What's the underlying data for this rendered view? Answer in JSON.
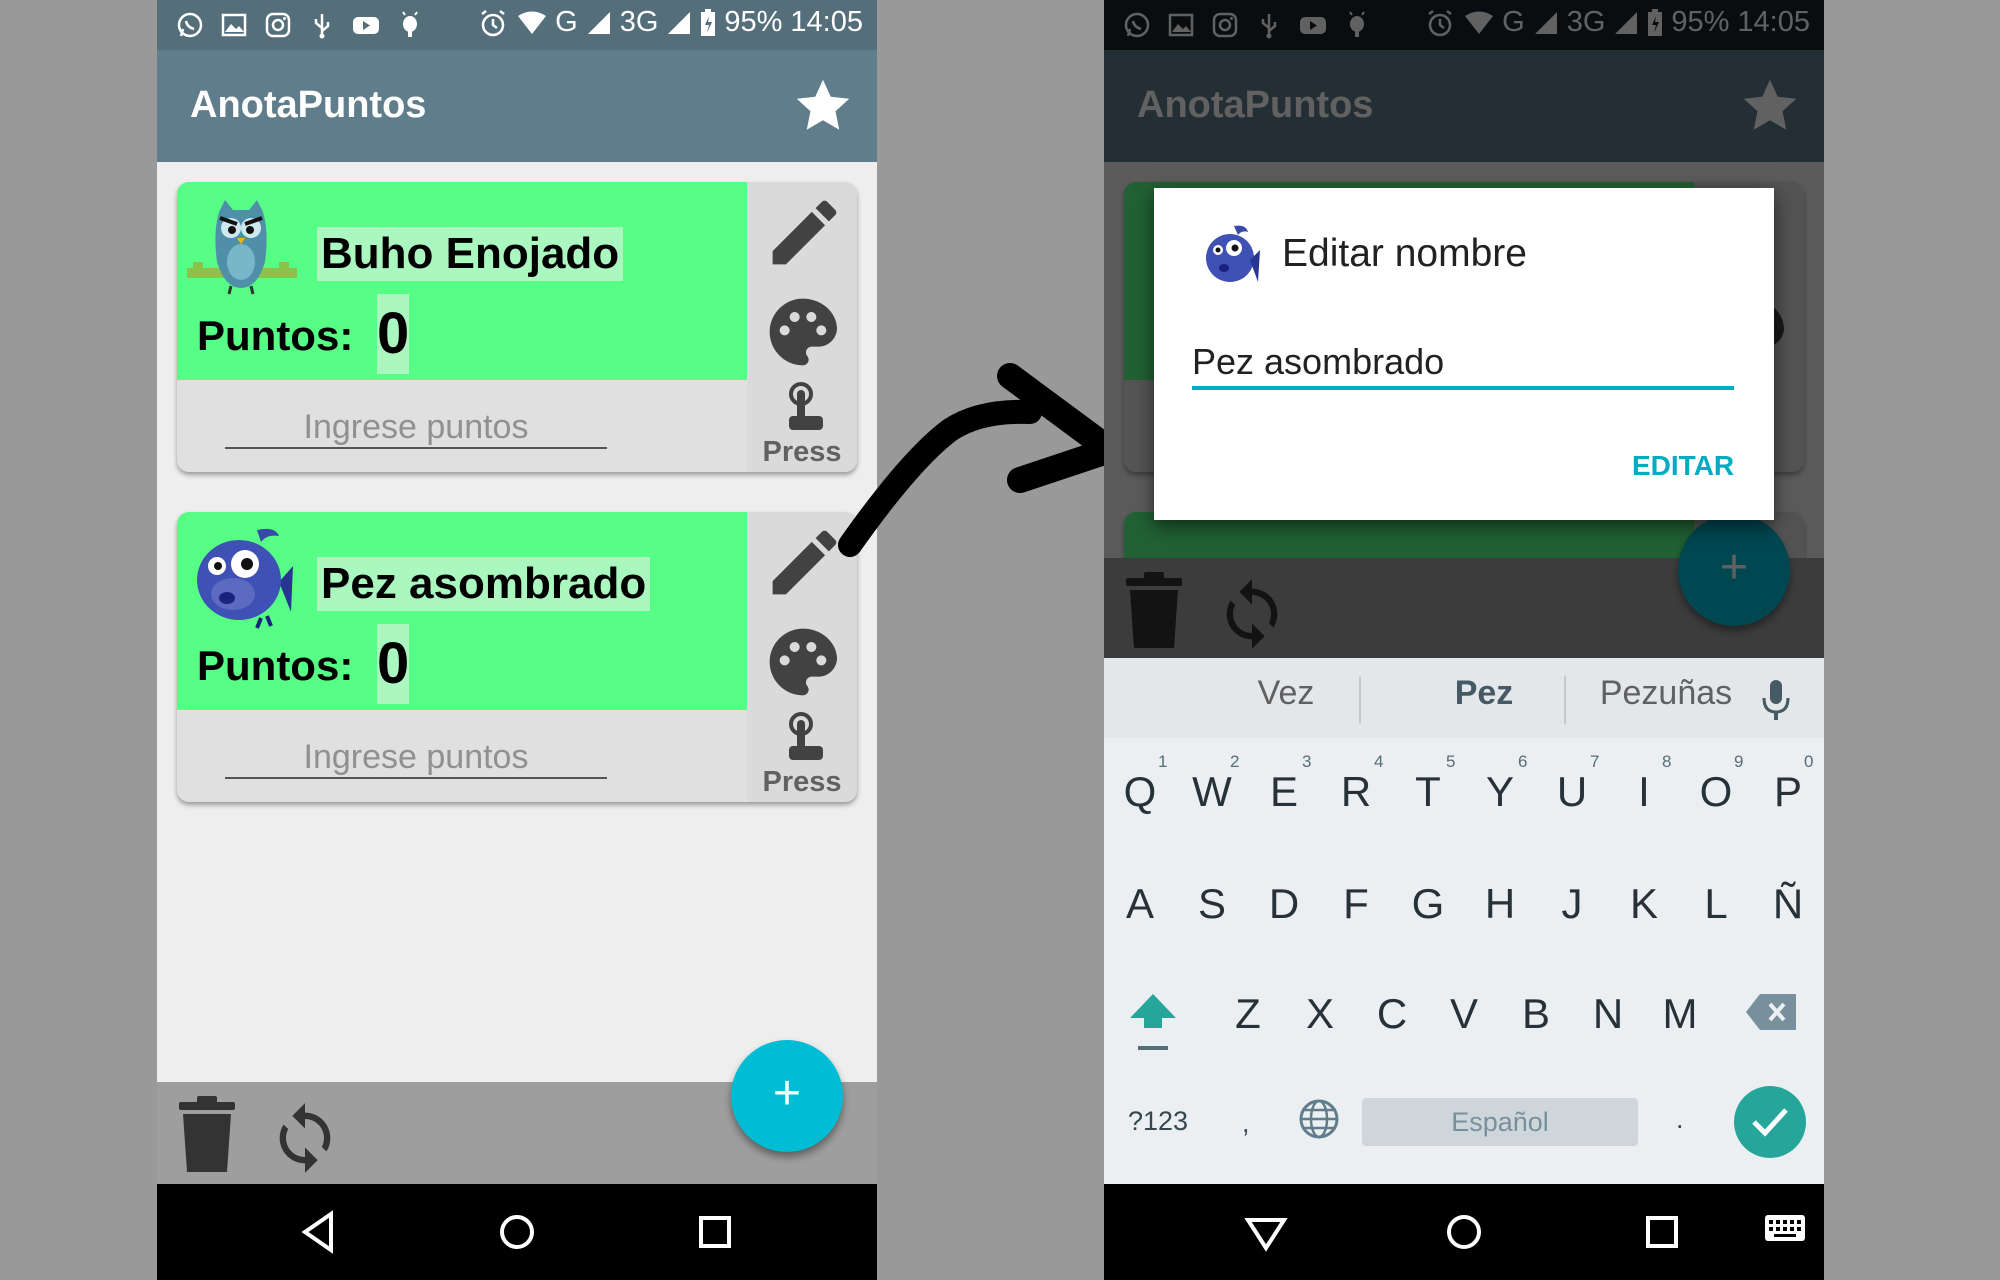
{
  "status": {
    "battery": "95%",
    "time": "14:05",
    "net_g": "G",
    "net_3g": "3G"
  },
  "app": {
    "title": "AnotaPuntos"
  },
  "cards": [
    {
      "name": "Buho Enojado",
      "points_label": "Puntos:",
      "points": "0",
      "placeholder": "Ingrese puntos",
      "press_label": "Press"
    },
    {
      "name": "Pez asombrado",
      "points_label": "Puntos:",
      "points": "0",
      "placeholder": "Ingrese puntos",
      "press_label": "Press"
    }
  ],
  "fab": {
    "label": "+"
  },
  "dialog": {
    "title": "Editar nombre",
    "value": "Pez asombrado",
    "button": "EDITAR"
  },
  "keyboard": {
    "suggestions": [
      "Vez",
      "Pez",
      "Pezuñas"
    ],
    "row1": [
      "Q",
      "W",
      "E",
      "R",
      "T",
      "Y",
      "U",
      "I",
      "O",
      "P"
    ],
    "row1_hints": [
      "1",
      "2",
      "3",
      "4",
      "5",
      "6",
      "7",
      "8",
      "9",
      "0"
    ],
    "row2": [
      "A",
      "S",
      "D",
      "F",
      "G",
      "H",
      "J",
      "K",
      "L",
      "Ñ"
    ],
    "row3": [
      "Z",
      "X",
      "C",
      "V",
      "B",
      "N",
      "M"
    ],
    "symbols": "?123",
    "comma": ",",
    "space": "Español",
    "period": "."
  },
  "colors": {
    "accent": "#00bcd4",
    "card_green": "#57fe86",
    "app_bar": "#607d8b",
    "status_bar": "#546e7a"
  }
}
